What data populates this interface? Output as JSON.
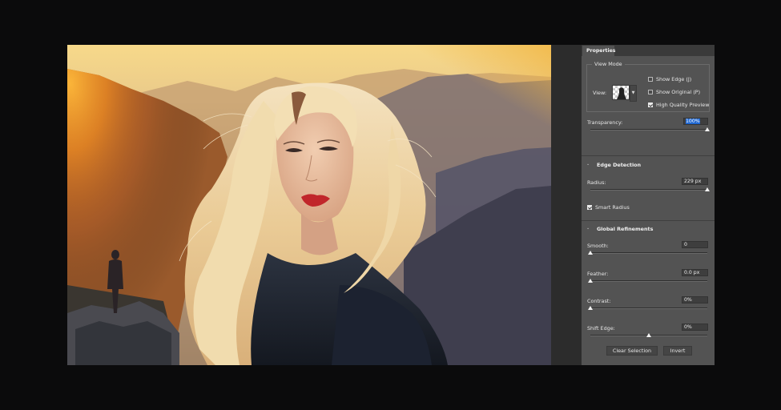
{
  "panel": {
    "tab_label": "Properties",
    "view_mode": {
      "legend": "View Mode",
      "view_label": "View:",
      "show_edge_label": "Show Edge (J)",
      "show_original_label": "Show Original (P)",
      "high_quality_label": "High Quality Preview",
      "show_edge_checked": false,
      "show_original_checked": false,
      "high_quality_checked": true
    },
    "transparency": {
      "label": "Transparency:",
      "value": "100%",
      "slider_fraction": 1.0
    },
    "edge_detection": {
      "header": "Edge Detection",
      "radius_label": "Radius:",
      "radius_value": "229 px",
      "radius_slider_fraction": 1.0,
      "smart_radius_label": "Smart Radius",
      "smart_radius_checked": true
    },
    "global_refinements": {
      "header": "Global Refinements",
      "smooth_label": "Smooth:",
      "smooth_value": "0",
      "smooth_fraction": 0.0,
      "feather_label": "Feather:",
      "feather_value": "0.0 px",
      "feather_fraction": 0.0,
      "contrast_label": "Contrast:",
      "contrast_value": "0%",
      "contrast_fraction": 0.0,
      "shift_edge_label": "Shift Edge:",
      "shift_edge_value": "0%",
      "shift_edge_fraction": 0.5
    },
    "buttons": {
      "clear_selection": "Clear Selection",
      "invert": "Invert"
    }
  },
  "colors": {
    "panel_bg": "#535353",
    "selection_highlight": "#1f67d1",
    "app_bg": "#262626"
  },
  "icons": {
    "section_toggle": "chevron-down-icon",
    "view_dropdown": "chevron-down-icon",
    "checkbox": "checkbox-icon"
  }
}
